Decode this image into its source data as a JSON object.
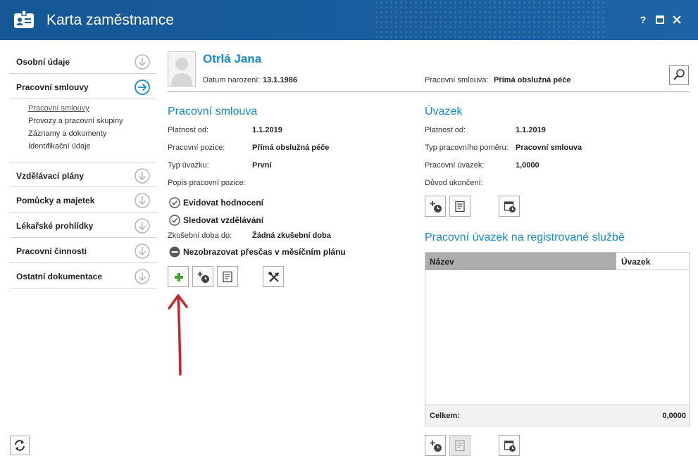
{
  "window": {
    "title": "Karta zaměstnance",
    "help_label": "?",
    "accent": "#1b8ac9",
    "titlebar_color": "#1a5c9c"
  },
  "sidebar": {
    "items": [
      {
        "label": "Osobní údaje",
        "icon": "arrow-down-circle-icon"
      },
      {
        "label": "Pracovní smlouvy",
        "icon": "arrow-right-circle-icon"
      },
      {
        "label": "Vzdělávací plány",
        "icon": "arrow-down-circle-icon"
      },
      {
        "label": "Pomůcky a majetek",
        "icon": "arrow-down-circle-icon"
      },
      {
        "label": "Lékařské prohlídky",
        "icon": "arrow-down-circle-icon"
      },
      {
        "label": "Pracovní činnosti",
        "icon": "arrow-down-circle-icon"
      },
      {
        "label": "Ostatní dokumentace",
        "icon": "arrow-down-circle-icon"
      }
    ],
    "subitems": [
      "Pracovní smlouvy",
      "Provozy a pracovní skupiny",
      "Záznamy a dokumenty",
      "Identifikační údaje"
    ]
  },
  "employee": {
    "name": "Otrlá Jana",
    "birth_label": "Datum narození:",
    "birth_value": "13.1.1986",
    "contract_label": "Pracovní smlouva:",
    "contract_value": "Přímá obslužná péče"
  },
  "contract": {
    "title": "Pracovní smlouva",
    "fields": [
      {
        "label": "Platnost od:",
        "value": "1.1.2019"
      },
      {
        "label": "Pracovní pozice:",
        "value": "Přímá obslužná péče"
      },
      {
        "label": "Typ úvazku:",
        "value": "První"
      },
      {
        "label": "Popis pracovní pozice:",
        "value": ""
      }
    ],
    "checks": [
      {
        "label": "Evidovat hodnocení",
        "state": "checked"
      },
      {
        "label": "Sledovat vzdělávání",
        "state": "checked"
      }
    ],
    "trial_label": "Zkušební doba do:",
    "trial_value": "Žádná zkušební doba",
    "overtime_label": "Nezobrazovat přesčas v měsíčním plánu"
  },
  "workload": {
    "title": "Úvazek",
    "fields": [
      {
        "label": "Platnost od:",
        "value": "1.1.2019"
      },
      {
        "label": "Typ pracovního poměru:",
        "value": "Pracovní smlouva"
      },
      {
        "label": "Pracovní úvazek:",
        "value": "1,0000"
      },
      {
        "label": "Důvod ukončení:",
        "value": ""
      }
    ]
  },
  "registered": {
    "title": "Pracovní úvazek na registrované službě",
    "columns": [
      "Název",
      "Úvazek"
    ],
    "rows": [],
    "total_label": "Celkem:",
    "total_value": "0,0000"
  }
}
